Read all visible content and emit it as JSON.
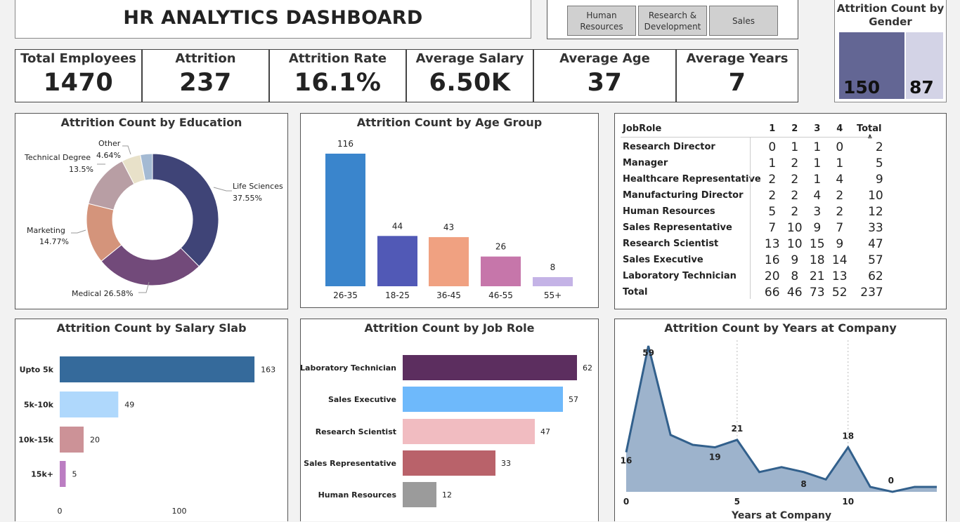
{
  "header": {
    "title": "HR ANALYTICS DASHBOARD"
  },
  "slicer": {
    "buttons": [
      {
        "line1": "Human",
        "line2": "Resources"
      },
      {
        "line1": "Research &",
        "line2": "Development"
      },
      {
        "line1": "Sales",
        "line2": ""
      }
    ]
  },
  "kpis": [
    {
      "label": "Total Employees",
      "value": "1470"
    },
    {
      "label": "Attrition",
      "value": "237"
    },
    {
      "label": "Attrition Rate",
      "value": "16.1%"
    },
    {
      "label": "Average Salary",
      "value": "6.50K"
    },
    {
      "label": "Average Age",
      "value": "37"
    },
    {
      "label": "Average Years",
      "value": "7"
    }
  ],
  "gender": {
    "title_line1": "Attrition Count by",
    "title_line2": "Gender",
    "male": "150",
    "female": "87",
    "colors": {
      "male": "#636694",
      "female": "#d3d3e6"
    }
  },
  "education": {
    "title": "Attrition Count by Education",
    "labels": {
      "life": "Life Sciences",
      "life_pct": "37.55%",
      "medical": "Medical 26.58%",
      "marketing": "Marketing",
      "marketing_pct": "14.77%",
      "technical": "Technical Degree",
      "technical_pct": "13.5%",
      "other": "Other",
      "other_pct": "4.64%"
    }
  },
  "age_group": {
    "title": "Attrition Count by Age Group"
  },
  "jobrole_matrix": {
    "headers": [
      "JobRole",
      "1",
      "2",
      "3",
      "4",
      "Total"
    ],
    "rows": [
      [
        "Research Director",
        "0",
        "1",
        "1",
        "0",
        "2"
      ],
      [
        "Manager",
        "1",
        "2",
        "1",
        "1",
        "5"
      ],
      [
        "Healthcare Representative",
        "2",
        "2",
        "1",
        "4",
        "9"
      ],
      [
        "Manufacturing Director",
        "2",
        "2",
        "4",
        "2",
        "10"
      ],
      [
        "Human Resources",
        "5",
        "2",
        "3",
        "2",
        "12"
      ],
      [
        "Sales Representative",
        "7",
        "10",
        "9",
        "7",
        "33"
      ],
      [
        "Research Scientist",
        "13",
        "10",
        "15",
        "9",
        "47"
      ],
      [
        "Sales Executive",
        "16",
        "9",
        "18",
        "14",
        "57"
      ],
      [
        "Laboratory Technician",
        "20",
        "8",
        "21",
        "13",
        "62"
      ],
      [
        "Total",
        "66",
        "46",
        "73",
        "52",
        "237"
      ]
    ]
  },
  "salary": {
    "title": "Attrition Count by Salary Slab"
  },
  "jobrole_bar": {
    "title": "Attrition Count by Job Role"
  },
  "years": {
    "title": "Attrition Count by Years at Company"
  },
  "chart_data": [
    {
      "type": "pie",
      "title": "Attrition Count by Education",
      "categories": [
        "Life Sciences",
        "Medical",
        "Marketing",
        "Technical Degree",
        "Other",
        "Unlabeled"
      ],
      "values": [
        37.55,
        26.58,
        14.77,
        13.5,
        4.64,
        2.96
      ],
      "colors": [
        "#3f4477",
        "#724a7a",
        "#d4947b",
        "#b89ea4",
        "#e8e1c9",
        "#a4bad3"
      ]
    },
    {
      "type": "bar",
      "title": "Attrition Count by Age Group",
      "categories": [
        "26-35",
        "18-25",
        "36-45",
        "46-55",
        "55+"
      ],
      "values": [
        116,
        44,
        43,
        26,
        8
      ],
      "colors": [
        "#3a85cc",
        "#5159b6",
        "#f0a181",
        "#c676aa",
        "#c4b3e6"
      ]
    },
    {
      "type": "bar",
      "title": "Attrition Count by Salary Slab",
      "categories": [
        "Upto 5k",
        "5k-10k",
        "10k-15k",
        "15k+"
      ],
      "values": [
        163,
        49,
        20,
        5
      ],
      "xticks": [
        "0",
        "100"
      ],
      "colors": [
        "#356a9b",
        "#afd8fc",
        "#cc9297",
        "#bb7dc2"
      ]
    },
    {
      "type": "bar",
      "title": "Attrition Count by Job Role",
      "categories": [
        "Laboratory Technician",
        "Sales Executive",
        "Research Scientist",
        "Sales Representative",
        "Human Resources"
      ],
      "values": [
        62,
        57,
        47,
        33,
        12
      ],
      "colors": [
        "#5c2e5f",
        "#6eb9fb",
        "#f1bcc1",
        "#b9626a",
        "#9b9b9b"
      ]
    },
    {
      "type": "area",
      "title": "Attrition Count by Years at Company",
      "xlabel": "Years at Company",
      "x": [
        0,
        1,
        2,
        3,
        4,
        5,
        6,
        7,
        8,
        9,
        10,
        11,
        12,
        13,
        14
      ],
      "values": [
        16,
        59,
        23,
        19,
        18,
        21,
        8,
        10,
        8,
        5,
        18,
        2,
        0,
        2,
        2
      ],
      "point_labels": {
        "0": "16",
        "1": "59",
        "4": "19",
        "5": "21",
        "8": "8",
        "10": "18",
        "12": "0",
        "14": "2"
      },
      "xticks": [
        "0",
        "5",
        "10"
      ],
      "colors": {
        "fill": "#9db3cc",
        "line": "#32608c"
      }
    }
  ]
}
